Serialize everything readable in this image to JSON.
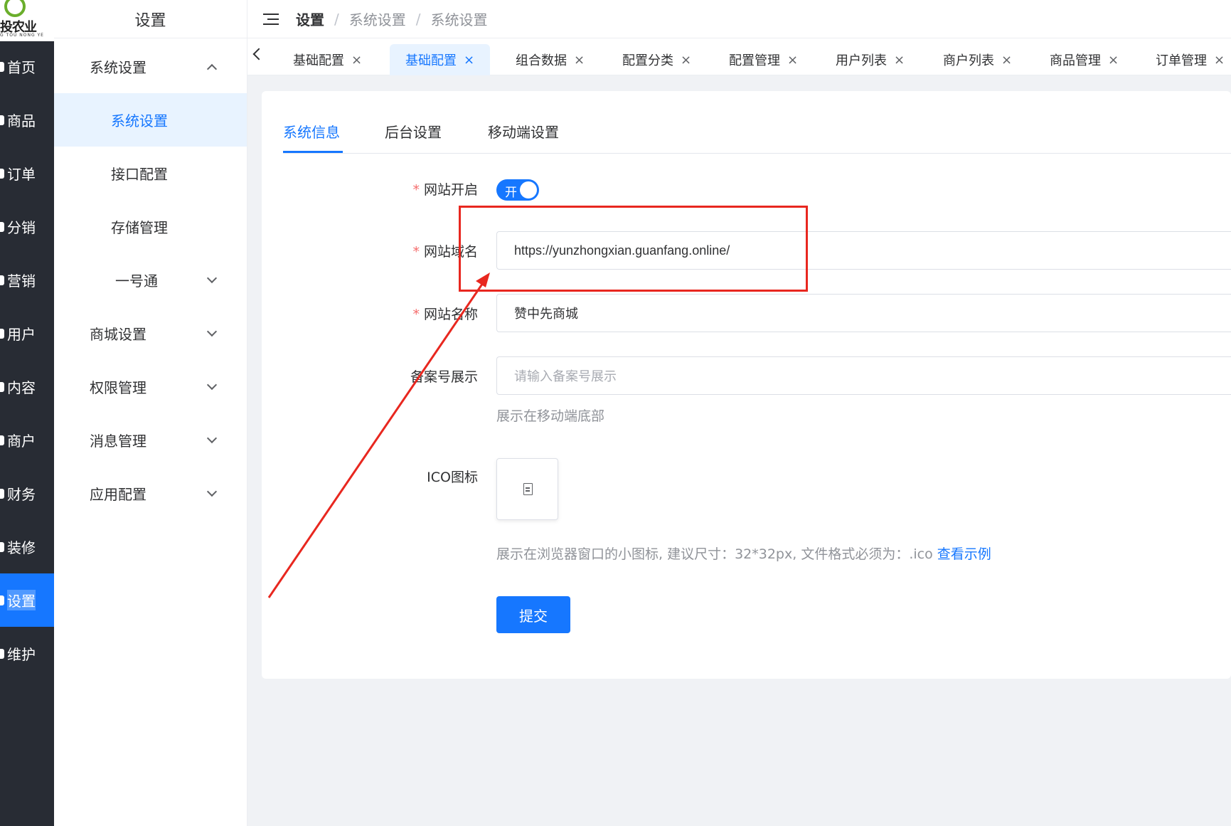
{
  "logo": {
    "brand": "投农业",
    "sub": "G TOU NONG YE"
  },
  "rail": [
    {
      "label": "首页"
    },
    {
      "label": "商品"
    },
    {
      "label": "订单"
    },
    {
      "label": "分销"
    },
    {
      "label": "营销"
    },
    {
      "label": "用户"
    },
    {
      "label": "内容"
    },
    {
      "label": "商户"
    },
    {
      "label": "财务"
    },
    {
      "label": "装修"
    },
    {
      "label": "设置",
      "active": true
    },
    {
      "label": "维护"
    }
  ],
  "sidebar": {
    "title": "设置",
    "items": [
      {
        "label": "系统设置",
        "chevron": "up"
      },
      {
        "label": "系统设置",
        "active": true
      },
      {
        "label": "接口配置"
      },
      {
        "label": "存储管理"
      },
      {
        "label": "一号通",
        "chevron": "down"
      },
      {
        "label": "商城设置",
        "chevron": "down"
      },
      {
        "label": "权限管理",
        "chevron": "down"
      },
      {
        "label": "消息管理",
        "chevron": "down"
      },
      {
        "label": "应用配置",
        "chevron": "down"
      }
    ]
  },
  "header": {
    "crumb1": "设置",
    "crumb2": "系统设置",
    "crumb3": "系统设置",
    "sep": "/"
  },
  "tabs": [
    {
      "label": "基础配置",
      "close": "×"
    },
    {
      "label": "基础配置",
      "close": "×",
      "active": true
    },
    {
      "label": "组合数据",
      "close": "×"
    },
    {
      "label": "配置分类",
      "close": "×"
    },
    {
      "label": "配置管理",
      "close": "×"
    },
    {
      "label": "用户列表",
      "close": "×"
    },
    {
      "label": "商户列表",
      "close": "×"
    },
    {
      "label": "商品管理",
      "close": "×"
    },
    {
      "label": "订单管理",
      "close": "×"
    }
  ],
  "content_tabs": {
    "t1": "系统信息",
    "t2": "后台设置",
    "t3": "移动端设置"
  },
  "form": {
    "required_mark": "*",
    "site_open_label": "网站开启",
    "switch_text": "开",
    "domain_label": "网站域名",
    "domain_value": "https://yunzhongxian.guanfang.online/",
    "name_label": "网站名称",
    "name_value": "赞中先商城",
    "icp_label": "备案号展示",
    "icp_placeholder": "请输入备案号展示",
    "icp_hint": "展示在移动端底部",
    "ico_label": "ICO图标",
    "ico_hint": "展示在浏览器窗口的小图标, 建议尺寸：32*32px, 文件格式必须为：.ico",
    "ico_hint_link": "查看示例",
    "submit": "提交"
  },
  "colors": {
    "primary": "#1677ff",
    "rail": "#282c34",
    "annotation": "#e8271f"
  }
}
